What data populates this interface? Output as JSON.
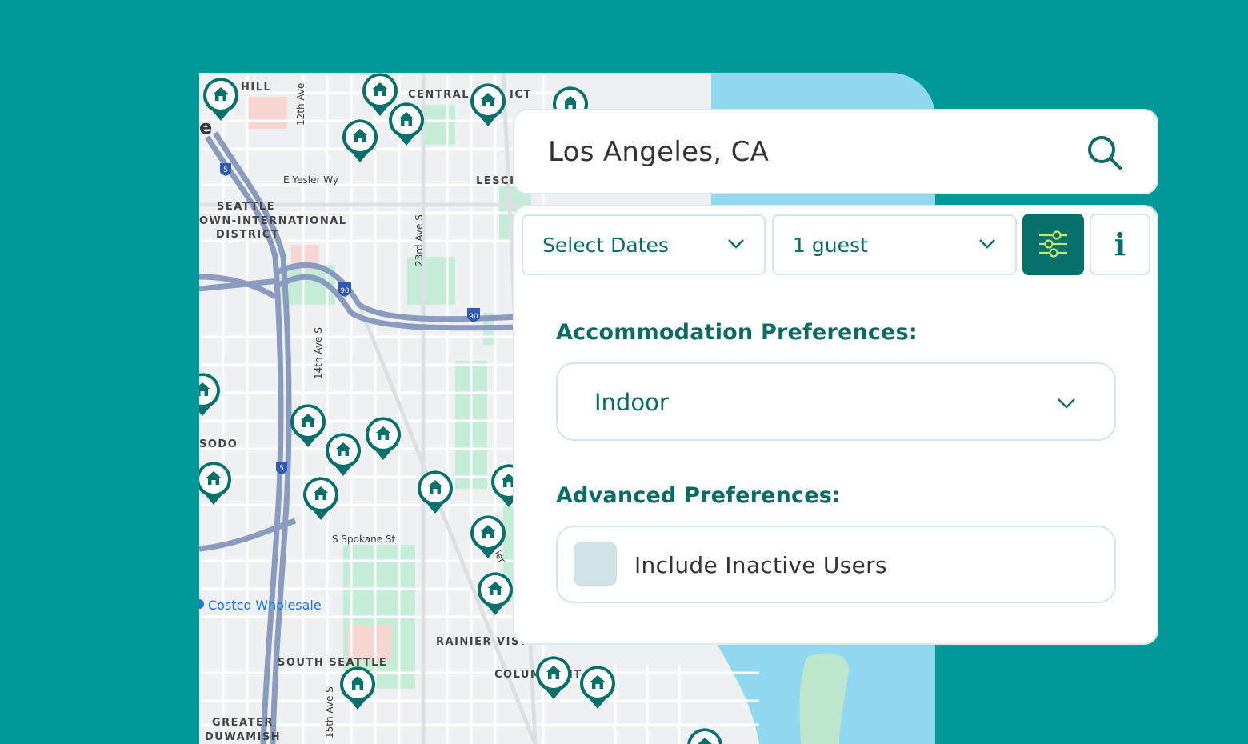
{
  "search": {
    "value": "Los Angeles, CA"
  },
  "filters": {
    "dates_label": "Select Dates",
    "guests_label": "1 guest"
  },
  "accommodation": {
    "title": "Accommodation Preferences:",
    "selected": "Indoor"
  },
  "advanced": {
    "title": "Advanced Preferences:",
    "checkbox_label": "Include Inactive Users",
    "checked": false
  },
  "map": {
    "neighborhood_labels": [
      "HILL",
      "CENTRAL",
      "ICT",
      "LESCH",
      "SEATTLE",
      "OWN-INTERNATIONAL",
      "DISTRICT",
      "SODO",
      "RAINIER VIST",
      "SOUTH SEATTLE",
      "COLUM",
      "IT",
      "GREATER",
      "DUWAMISH",
      "e"
    ],
    "street_labels": [
      "12th Ave",
      "E Yesler Wy",
      "23rd Ave S",
      "14th Ave S",
      "S Spokane St",
      "15th Ave S",
      "ier"
    ],
    "highway_shields": [
      "5",
      "90",
      "90",
      "5"
    ],
    "poi": "Costco Wholesale"
  },
  "colors": {
    "background": "#009999",
    "primary": "#08706b",
    "accent_icon": "#c6e86a",
    "water": "#8fd8f0",
    "park": "#c5ecd6"
  }
}
